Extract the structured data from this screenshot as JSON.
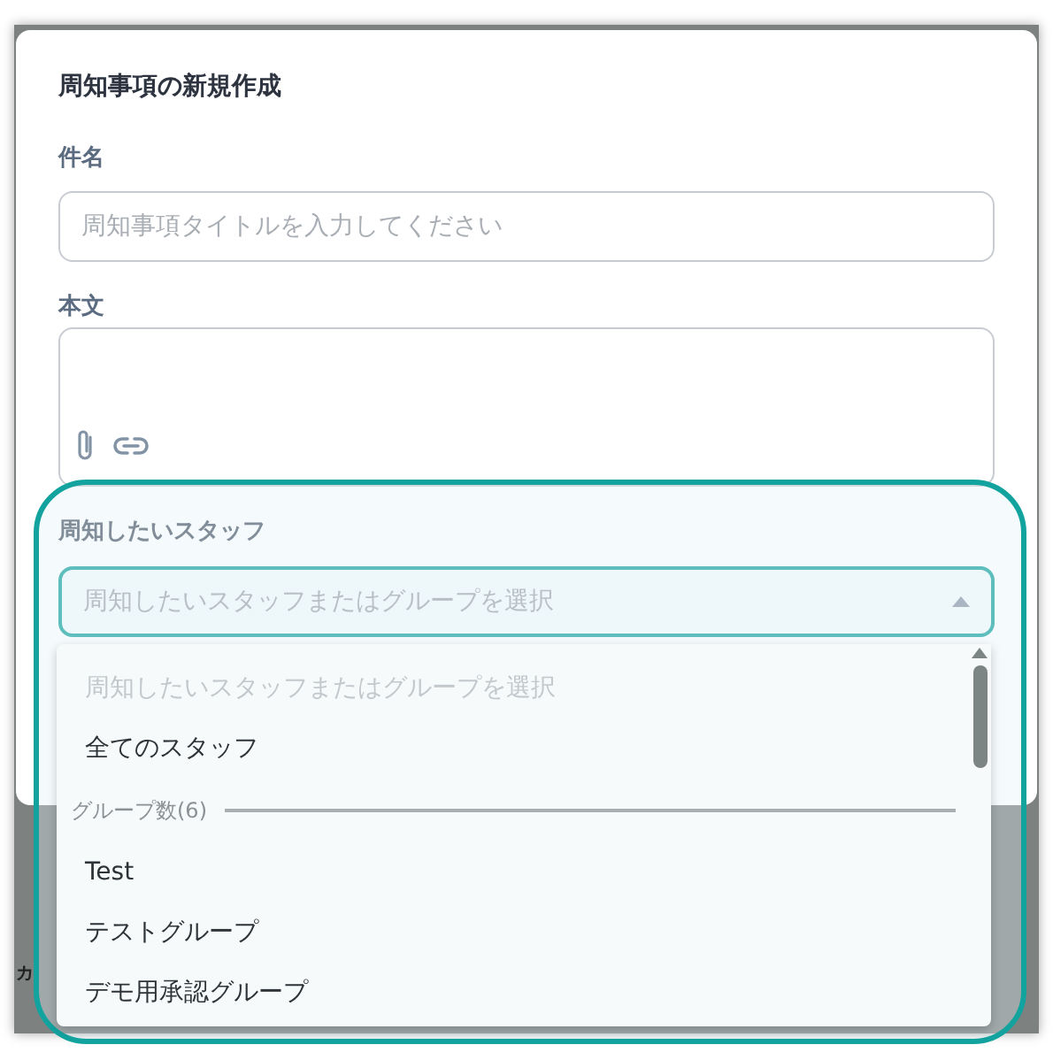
{
  "dialog": {
    "title": "周知事項の新規作成",
    "subject": {
      "label": "件名",
      "placeholder": "周知事項タイトルを入力してください"
    },
    "body": {
      "label": "本文"
    },
    "staff": {
      "label": "周知したいスタッフ",
      "placeholder": "周知したいスタッフまたはグループを選択",
      "expanded": true
    }
  },
  "dropdown": {
    "items": [
      {
        "kind": "option",
        "label": "周知したいスタッフまたはグループを選択",
        "disabled": true
      },
      {
        "kind": "option",
        "label": "全てのスタッフ",
        "disabled": false
      },
      {
        "kind": "group",
        "label": "グループ数(6)"
      },
      {
        "kind": "option",
        "label": "Test",
        "disabled": false
      },
      {
        "kind": "option",
        "label": "テストグループ",
        "disabled": false
      },
      {
        "kind": "option",
        "label": "デモ用承認グループ",
        "disabled": false
      }
    ]
  },
  "background": {
    "text": "カ"
  }
}
